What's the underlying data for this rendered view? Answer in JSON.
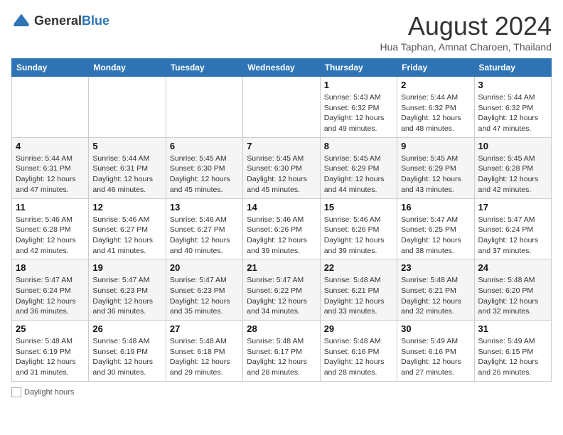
{
  "header": {
    "logo_general": "General",
    "logo_blue": "Blue",
    "month_title": "August 2024",
    "subtitle": "Hua Taphan, Amnat Charoen, Thailand"
  },
  "days_of_week": [
    "Sunday",
    "Monday",
    "Tuesday",
    "Wednesday",
    "Thursday",
    "Friday",
    "Saturday"
  ],
  "weeks": [
    [
      {
        "day": "",
        "info": ""
      },
      {
        "day": "",
        "info": ""
      },
      {
        "day": "",
        "info": ""
      },
      {
        "day": "",
        "info": ""
      },
      {
        "day": "1",
        "info": "Sunrise: 5:43 AM\nSunset: 6:32 PM\nDaylight: 12 hours and 49 minutes."
      },
      {
        "day": "2",
        "info": "Sunrise: 5:44 AM\nSunset: 6:32 PM\nDaylight: 12 hours and 48 minutes."
      },
      {
        "day": "3",
        "info": "Sunrise: 5:44 AM\nSunset: 6:32 PM\nDaylight: 12 hours and 47 minutes."
      }
    ],
    [
      {
        "day": "4",
        "info": "Sunrise: 5:44 AM\nSunset: 6:31 PM\nDaylight: 12 hours and 47 minutes."
      },
      {
        "day": "5",
        "info": "Sunrise: 5:44 AM\nSunset: 6:31 PM\nDaylight: 12 hours and 46 minutes."
      },
      {
        "day": "6",
        "info": "Sunrise: 5:45 AM\nSunset: 6:30 PM\nDaylight: 12 hours and 45 minutes."
      },
      {
        "day": "7",
        "info": "Sunrise: 5:45 AM\nSunset: 6:30 PM\nDaylight: 12 hours and 45 minutes."
      },
      {
        "day": "8",
        "info": "Sunrise: 5:45 AM\nSunset: 6:29 PM\nDaylight: 12 hours and 44 minutes."
      },
      {
        "day": "9",
        "info": "Sunrise: 5:45 AM\nSunset: 6:29 PM\nDaylight: 12 hours and 43 minutes."
      },
      {
        "day": "10",
        "info": "Sunrise: 5:45 AM\nSunset: 6:28 PM\nDaylight: 12 hours and 42 minutes."
      }
    ],
    [
      {
        "day": "11",
        "info": "Sunrise: 5:46 AM\nSunset: 6:28 PM\nDaylight: 12 hours and 42 minutes."
      },
      {
        "day": "12",
        "info": "Sunrise: 5:46 AM\nSunset: 6:27 PM\nDaylight: 12 hours and 41 minutes."
      },
      {
        "day": "13",
        "info": "Sunrise: 5:46 AM\nSunset: 6:27 PM\nDaylight: 12 hours and 40 minutes."
      },
      {
        "day": "14",
        "info": "Sunrise: 5:46 AM\nSunset: 6:26 PM\nDaylight: 12 hours and 39 minutes."
      },
      {
        "day": "15",
        "info": "Sunrise: 5:46 AM\nSunset: 6:26 PM\nDaylight: 12 hours and 39 minutes."
      },
      {
        "day": "16",
        "info": "Sunrise: 5:47 AM\nSunset: 6:25 PM\nDaylight: 12 hours and 38 minutes."
      },
      {
        "day": "17",
        "info": "Sunrise: 5:47 AM\nSunset: 6:24 PM\nDaylight: 12 hours and 37 minutes."
      }
    ],
    [
      {
        "day": "18",
        "info": "Sunrise: 5:47 AM\nSunset: 6:24 PM\nDaylight: 12 hours and 36 minutes."
      },
      {
        "day": "19",
        "info": "Sunrise: 5:47 AM\nSunset: 6:23 PM\nDaylight: 12 hours and 36 minutes."
      },
      {
        "day": "20",
        "info": "Sunrise: 5:47 AM\nSunset: 6:23 PM\nDaylight: 12 hours and 35 minutes."
      },
      {
        "day": "21",
        "info": "Sunrise: 5:47 AM\nSunset: 6:22 PM\nDaylight: 12 hours and 34 minutes."
      },
      {
        "day": "22",
        "info": "Sunrise: 5:48 AM\nSunset: 6:21 PM\nDaylight: 12 hours and 33 minutes."
      },
      {
        "day": "23",
        "info": "Sunrise: 5:48 AM\nSunset: 6:21 PM\nDaylight: 12 hours and 32 minutes."
      },
      {
        "day": "24",
        "info": "Sunrise: 5:48 AM\nSunset: 6:20 PM\nDaylight: 12 hours and 32 minutes."
      }
    ],
    [
      {
        "day": "25",
        "info": "Sunrise: 5:48 AM\nSunset: 6:19 PM\nDaylight: 12 hours and 31 minutes."
      },
      {
        "day": "26",
        "info": "Sunrise: 5:48 AM\nSunset: 6:19 PM\nDaylight: 12 hours and 30 minutes."
      },
      {
        "day": "27",
        "info": "Sunrise: 5:48 AM\nSunset: 6:18 PM\nDaylight: 12 hours and 29 minutes."
      },
      {
        "day": "28",
        "info": "Sunrise: 5:48 AM\nSunset: 6:17 PM\nDaylight: 12 hours and 28 minutes."
      },
      {
        "day": "29",
        "info": "Sunrise: 5:48 AM\nSunset: 6:16 PM\nDaylight: 12 hours and 28 minutes."
      },
      {
        "day": "30",
        "info": "Sunrise: 5:49 AM\nSunset: 6:16 PM\nDaylight: 12 hours and 27 minutes."
      },
      {
        "day": "31",
        "info": "Sunrise: 5:49 AM\nSunset: 6:15 PM\nDaylight: 12 hours and 26 minutes."
      }
    ]
  ],
  "legend": {
    "daylight_label": "Daylight hours"
  },
  "colors": {
    "header_bg": "#2e74b5"
  }
}
